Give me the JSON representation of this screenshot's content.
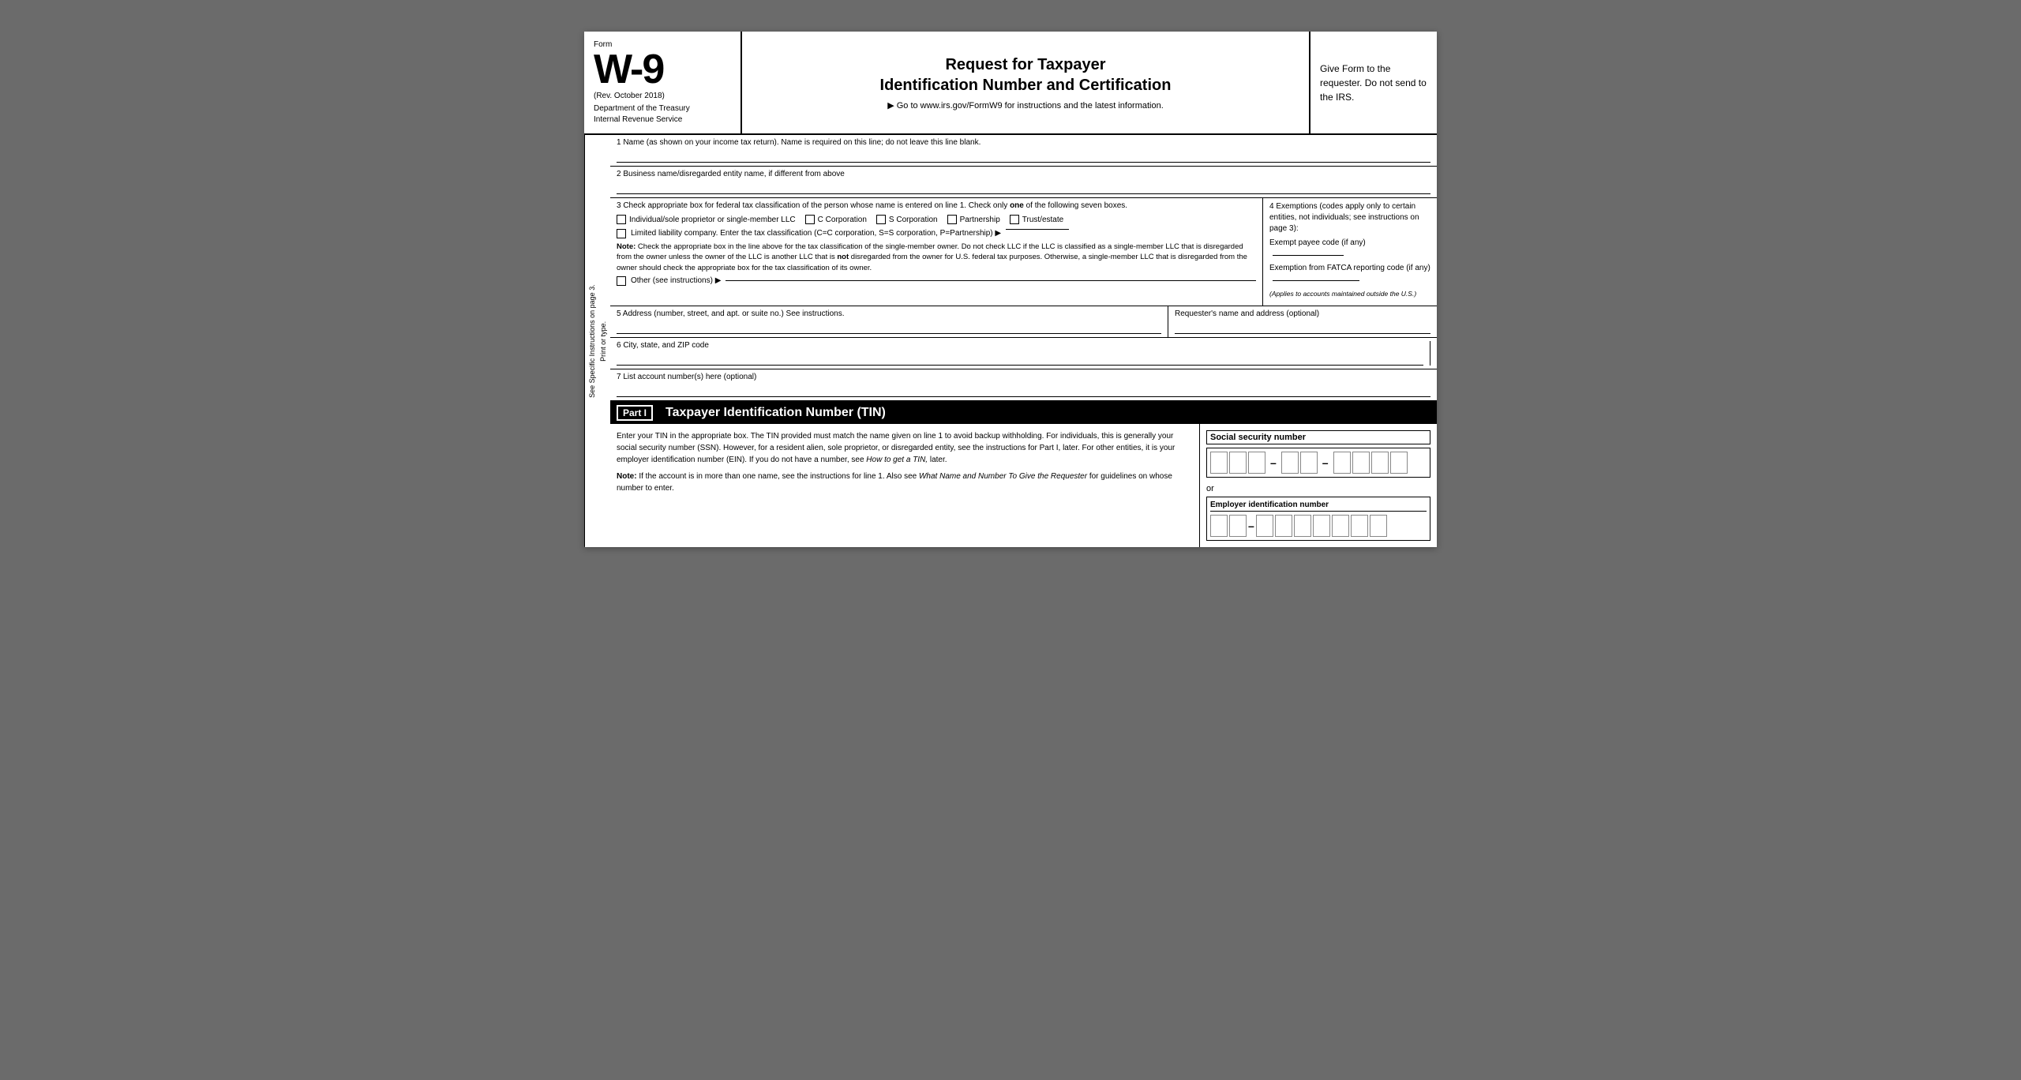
{
  "header": {
    "form_label": "Form",
    "form_number": "W-9",
    "rev_date": "(Rev. October 2018)",
    "dept": "Department of the Treasury",
    "irs": "Internal Revenue Service",
    "title_line1": "Request for Taxpayer",
    "title_line2": "Identification Number and Certification",
    "instructions": "▶ Go to www.irs.gov/FormW9 for instructions and the latest information.",
    "give_form": "Give Form to the requester. Do not send to the IRS."
  },
  "sidebar": {
    "print_or_type": "Print or type.",
    "see_specific": "See Specific Instructions on page 3."
  },
  "fields": {
    "line1_label": "1  Name (as shown on your income tax return). Name is required on this line; do not leave this line blank.",
    "line2_label": "2  Business name/disregarded entity name, if different from above",
    "line3_label": "3  Check appropriate box for federal tax classification of the person whose name is entered on line 1. Check only",
    "line3_label_bold": "one",
    "line3_label_end": "of the following seven boxes.",
    "checkboxes": [
      {
        "id": "indiv",
        "label": "Individual/sole proprietor or single-member LLC"
      },
      {
        "id": "ccorp",
        "label": "C Corporation"
      },
      {
        "id": "scorp",
        "label": "S Corporation"
      },
      {
        "id": "partner",
        "label": "Partnership"
      },
      {
        "id": "trust",
        "label": "Trust/estate"
      }
    ],
    "llc_label": "Limited liability company. Enter the tax classification (C=C corporation, S=S corporation, P=Partnership) ▶",
    "note_text": "Note: Check the appropriate box in the line above for the tax classification of the single-member owner.  Do not check LLC if the LLC is classified as a single-member LLC that is disregarded from the owner unless the owner of the LLC is another LLC that is not disregarded from the owner for U.S. federal tax purposes. Otherwise, a single-member LLC that is disregarded from the owner should check the appropriate box for the tax classification of its owner.",
    "not_bold": "not",
    "other_label": "Other (see instructions) ▶",
    "line5_label": "5  Address (number, street, and apt. or suite no.) See instructions.",
    "requesters_label": "Requester's name and address (optional)",
    "line6_label": "6  City, state, and ZIP code",
    "line7_label": "7  List account number(s) here (optional)"
  },
  "exemptions": {
    "title": "4  Exemptions (codes apply only to certain entities, not individuals; see instructions on page 3):",
    "exempt_payee_label": "Exempt payee code (if any)",
    "fatca_label": "Exemption from FATCA reporting code (if any)",
    "applies_note": "(Applies to accounts maintained outside the U.S.)"
  },
  "part1": {
    "label": "Part I",
    "title": "Taxpayer Identification Number (TIN)",
    "body_text": "Enter your TIN in the appropriate box. The TIN provided must match the name given on line 1 to avoid backup withholding. For individuals, this is generally your social security number (SSN). However, for a resident alien, sole proprietor, or disregarded entity, see the instructions for Part I, later. For other entities, it is your employer identification number (EIN). If you do not have a number, see How to get a TIN, later.",
    "how_to_get": "How to get a TIN,",
    "note": "Note:",
    "note_text": "If the account is in more than one name, see the instructions for line 1. Also see What Name and Number To Give the Requester for guidelines on whose number to enter.",
    "what_name": "What Name and Number To Give the Requester",
    "ssn_label": "Social security number",
    "or_text": "or",
    "ein_label": "Employer identification number",
    "ssn_groups": [
      3,
      2,
      4
    ],
    "ein_groups": [
      2,
      7
    ]
  }
}
